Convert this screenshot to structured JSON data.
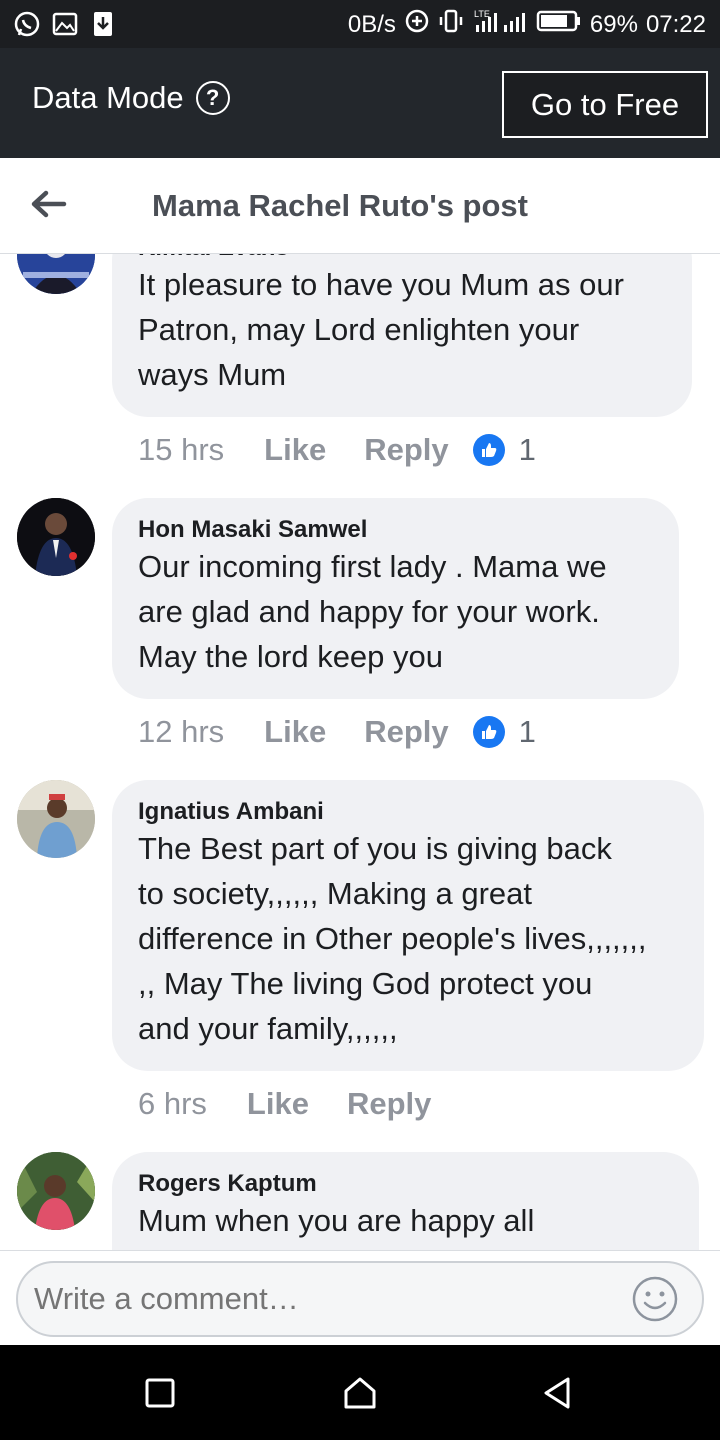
{
  "status_bar": {
    "speed": "0B/s",
    "network": "LTE",
    "battery": "69%",
    "time": "07:22"
  },
  "data_bar": {
    "mode_label": "Data Mode",
    "help_glyph": "?",
    "go_free_label": "Go to Free"
  },
  "header": {
    "title": "Mama Rachel Ruto's post"
  },
  "comments": [
    {
      "author": "Kimtai Evans",
      "text_lines": [
        "It pleasure to have you Mum as our",
        "Patron, may Lord enlighten your",
        "ways Mum"
      ],
      "time": "15 hrs",
      "like": "Like",
      "reply": "Reply",
      "reactions": "1"
    },
    {
      "author": "Hon Masaki Samwel",
      "text_lines": [
        "Our incoming first lady . Mama we",
        "are glad and happy for your work.",
        "May the lord keep you"
      ],
      "time": "12 hrs",
      "like": "Like",
      "reply": "Reply",
      "reactions": "1"
    },
    {
      "author": "Ignatius Ambani",
      "text_lines": [
        "The Best part of you is giving back",
        "to society,,,,,, Making a great",
        "difference in Other people's lives,,,,,,,",
        ",, May The living God protect you",
        "and your family,,,,,,"
      ],
      "time": "6 hrs",
      "like": "Like",
      "reply": "Reply"
    },
    {
      "author": "Rogers Kaptum",
      "text_lines": [
        "Mum when you are happy all"
      ]
    }
  ],
  "composer": {
    "placeholder": "Write a comment…"
  },
  "colors": {
    "accent": "#1877f2",
    "bubble": "#f0f1f4",
    "meta": "#90949c"
  }
}
